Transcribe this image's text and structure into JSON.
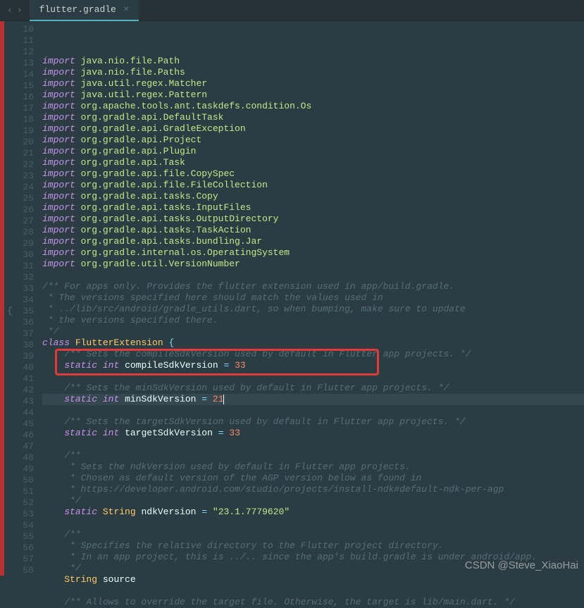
{
  "topbar": {
    "back": "‹",
    "fwd": "›",
    "tab_label": "flutter.gradle",
    "tab_close": "×"
  },
  "gutter_start": 10,
  "gutter_end": 58,
  "brace_line": 35,
  "cursor_line": 40,
  "highlight": {
    "top_line": 39,
    "bottom_line": 40
  },
  "lines": [
    {
      "t": "import",
      "pkg": "java.nio.file.Path"
    },
    {
      "t": "import",
      "pkg": "java.nio.file.Paths"
    },
    {
      "t": "import",
      "pkg": "java.util.regex.Matcher"
    },
    {
      "t": "import",
      "pkg": "java.util.regex.Pattern"
    },
    {
      "t": "import",
      "pkg": "org.apache.tools.ant.taskdefs.condition.Os"
    },
    {
      "t": "import",
      "pkg": "org.gradle.api.DefaultTask"
    },
    {
      "t": "import",
      "pkg": "org.gradle.api.GradleException"
    },
    {
      "t": "import",
      "pkg": "org.gradle.api.Project"
    },
    {
      "t": "import",
      "pkg": "org.gradle.api.Plugin"
    },
    {
      "t": "import",
      "pkg": "org.gradle.api.Task"
    },
    {
      "t": "import",
      "pkg": "org.gradle.api.file.CopySpec"
    },
    {
      "t": "import",
      "pkg": "org.gradle.api.file.FileCollection"
    },
    {
      "t": "import",
      "pkg": "org.gradle.api.tasks.Copy"
    },
    {
      "t": "import",
      "pkg": "org.gradle.api.tasks.InputFiles"
    },
    {
      "t": "import",
      "pkg": "org.gradle.api.tasks.OutputDirectory"
    },
    {
      "t": "import",
      "pkg": "org.gradle.api.tasks.TaskAction"
    },
    {
      "t": "import",
      "pkg": "org.gradle.api.tasks.bundling.Jar"
    },
    {
      "t": "import",
      "pkg": "org.gradle.internal.os.OperatingSystem"
    },
    {
      "t": "import",
      "pkg": "org.gradle.util.VersionNumber"
    },
    {
      "t": "blank"
    },
    {
      "t": "comment",
      "text": "/** For apps only. Provides the flutter extension used in app/build.gradle."
    },
    {
      "t": "comment",
      "text": " * The versions specified here should match the values used in"
    },
    {
      "t": "comment",
      "text": " * ../lib/src/android/gradle_utils.dart, so when bumping, make sure to update"
    },
    {
      "t": "comment",
      "text": " * the versions specified there."
    },
    {
      "t": "comment",
      "text": " */"
    },
    {
      "t": "classdecl",
      "kw": "class",
      "name": "FlutterExtension"
    },
    {
      "t": "comment",
      "indent": 1,
      "text": "/** Sets the compileSdkVersion used by default in Flutter app projects. */"
    },
    {
      "t": "staticint",
      "indent": 1,
      "name": "compileSdkVersion",
      "val": "33"
    },
    {
      "t": "blank"
    },
    {
      "t": "comment",
      "indent": 1,
      "text": "/** Sets the minSdkVersion used by default in Flutter app projects. */"
    },
    {
      "t": "staticint",
      "indent": 1,
      "name": "minSdkVersion",
      "val": "21",
      "cursor": true
    },
    {
      "t": "blank"
    },
    {
      "t": "comment",
      "indent": 1,
      "text": "/** Sets the targetSdkVersion used by default in Flutter app projects. */"
    },
    {
      "t": "staticint",
      "indent": 1,
      "name": "targetSdkVersion",
      "val": "33"
    },
    {
      "t": "blank"
    },
    {
      "t": "comment",
      "indent": 1,
      "text": "/**"
    },
    {
      "t": "comment",
      "indent": 1,
      "text": " * Sets the ndkVersion used by default in Flutter app projects."
    },
    {
      "t": "comment",
      "indent": 1,
      "text": " * Chosen as default version of the AGP version below as found in"
    },
    {
      "t": "comment",
      "indent": 1,
      "text": " * https://developer.android.com/studio/projects/install-ndk#default-ndk-per-agp"
    },
    {
      "t": "comment",
      "indent": 1,
      "text": " */"
    },
    {
      "t": "staticstr",
      "indent": 1,
      "name": "ndkVersion",
      "val": "\"23.1.7779620\""
    },
    {
      "t": "blank"
    },
    {
      "t": "comment",
      "indent": 1,
      "text": "/**"
    },
    {
      "t": "comment",
      "indent": 1,
      "text": " * Specifies the relative directory to the Flutter project directory."
    },
    {
      "t": "comment",
      "indent": 1,
      "text": " * In an app project, this is ../.. since the app's build.gradle is under android/app."
    },
    {
      "t": "comment",
      "indent": 1,
      "text": " */"
    },
    {
      "t": "strdecl",
      "indent": 1,
      "name": "source"
    },
    {
      "t": "blank"
    },
    {
      "t": "comment",
      "indent": 1,
      "text": "/** Allows to override the target file. Otherwise, the target is lib/main.dart. */"
    }
  ],
  "watermark": "CSDN @Steve_XiaoHai"
}
